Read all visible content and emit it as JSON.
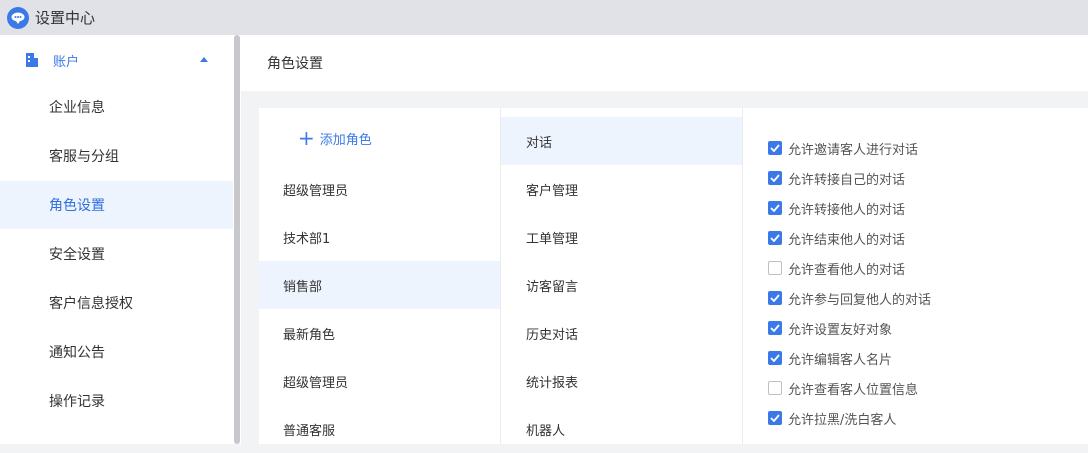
{
  "window": {
    "title": "设置中心"
  },
  "sidebar": {
    "group": {
      "label": "账户",
      "icon": "building-icon",
      "expanded": true
    },
    "items": [
      {
        "label": "企业信息",
        "active": false
      },
      {
        "label": "客服与分组",
        "active": false
      },
      {
        "label": "角色设置",
        "active": true
      },
      {
        "label": "安全设置",
        "active": false
      },
      {
        "label": "客户信息授权",
        "active": false
      },
      {
        "label": "通知公告",
        "active": false
      },
      {
        "label": "操作记录",
        "active": false
      }
    ]
  },
  "header": {
    "title": "角色设置"
  },
  "roles": {
    "add_label": "添加角色",
    "items": [
      {
        "label": "超级管理员",
        "active": false
      },
      {
        "label": "技术部1",
        "active": false
      },
      {
        "label": "销售部",
        "active": true
      },
      {
        "label": "最新角色",
        "active": false
      },
      {
        "label": "超级管理员",
        "active": false
      },
      {
        "label": "普通客服",
        "active": false
      }
    ]
  },
  "modules": {
    "items": [
      {
        "label": "对话",
        "active": true
      },
      {
        "label": "客户管理",
        "active": false
      },
      {
        "label": "工单管理",
        "active": false
      },
      {
        "label": "访客留言",
        "active": false
      },
      {
        "label": "历史对话",
        "active": false
      },
      {
        "label": "统计报表",
        "active": false
      },
      {
        "label": "机器人",
        "active": false
      }
    ]
  },
  "permissions": {
    "items": [
      {
        "label": "允许邀请客人进行对话",
        "checked": true
      },
      {
        "label": "允许转接自己的对话",
        "checked": true
      },
      {
        "label": "允许转接他人的对话",
        "checked": true
      },
      {
        "label": "允许结束他人的对话",
        "checked": true
      },
      {
        "label": "允许查看他人的对话",
        "checked": false
      },
      {
        "label": "允许参与回复他人的对话",
        "checked": true
      },
      {
        "label": "允许设置友好对象",
        "checked": true
      },
      {
        "label": "允许编辑客人名片",
        "checked": true
      },
      {
        "label": "允许查看客人位置信息",
        "checked": false
      },
      {
        "label": "允许拉黑/洗白客人",
        "checked": true
      }
    ]
  },
  "colors": {
    "accent": "#3b79e8",
    "active_bg": "#eef4fe",
    "page_bg": "#f2f3f5"
  }
}
